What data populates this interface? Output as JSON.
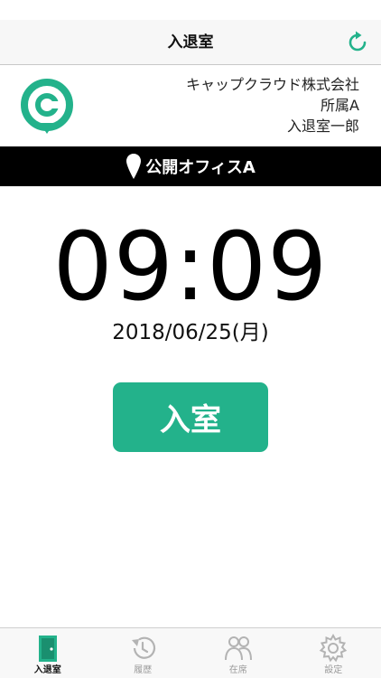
{
  "header": {
    "title": "入退室",
    "refresh_icon": "refresh-icon"
  },
  "company": {
    "name": "キャップクラウド株式会社",
    "department": "所属A",
    "user": "入退室一郎",
    "logo_icon": "brand-logo-icon"
  },
  "location": {
    "name": "公開オフィスA",
    "icon": "map-pin-icon"
  },
  "clock": {
    "time": "09:09",
    "date": "2018/06/25(月)"
  },
  "actions": {
    "enter_label": "入室"
  },
  "tabs": [
    {
      "label": "入退室",
      "icon": "door-icon",
      "active": true
    },
    {
      "label": "履歴",
      "icon": "history-icon",
      "active": false
    },
    {
      "label": "在席",
      "icon": "people-icon",
      "active": false
    },
    {
      "label": "設定",
      "icon": "gear-icon",
      "active": false
    }
  ],
  "colors": {
    "accent": "#23b28b",
    "location_bar": "#000000",
    "tab_inactive": "#9a9a9a"
  }
}
